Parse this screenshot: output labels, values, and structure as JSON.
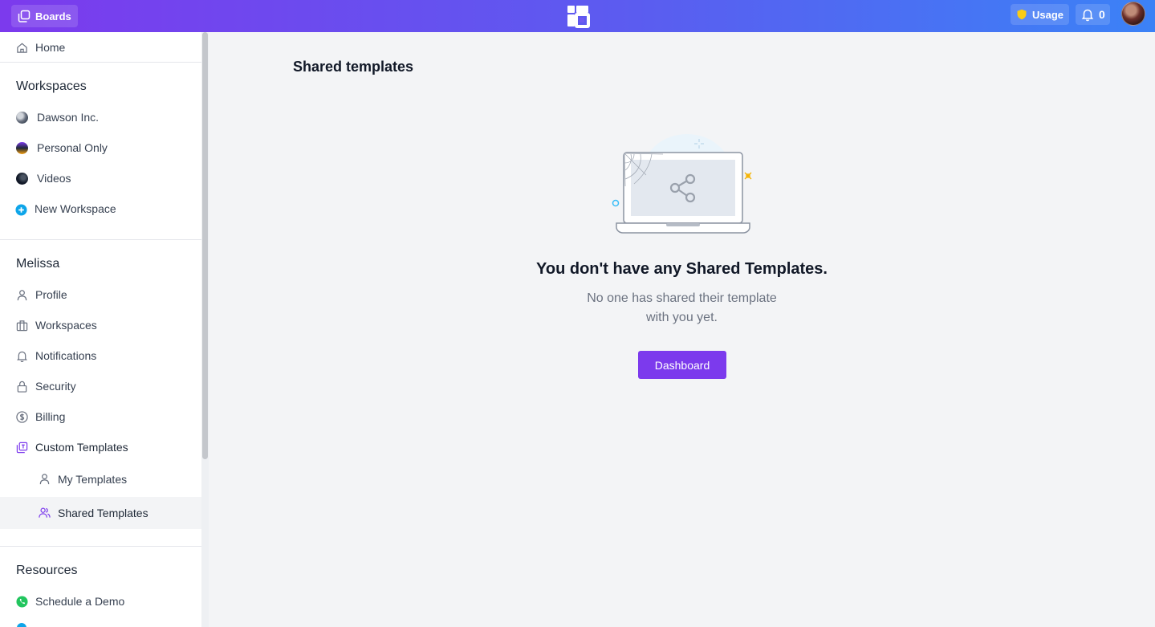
{
  "topbar": {
    "boards_label": "Boards",
    "usage_label": "Usage",
    "notification_count": "0"
  },
  "sidebar": {
    "home": "Home",
    "workspaces_title": "Workspaces",
    "workspaces": [
      {
        "label": "Dawson Inc."
      },
      {
        "label": "Personal Only"
      },
      {
        "label": "Videos"
      }
    ],
    "new_workspace": "New Workspace",
    "user_title": "Melissa",
    "user_items": [
      {
        "label": "Profile",
        "icon": "user-icon"
      },
      {
        "label": "Workspaces",
        "icon": "briefcase-icon"
      },
      {
        "label": "Notifications",
        "icon": "bell-icon"
      },
      {
        "label": "Security",
        "icon": "lock-icon"
      },
      {
        "label": "Billing",
        "icon": "dollar-icon"
      },
      {
        "label": "Custom Templates",
        "icon": "template-icon"
      }
    ],
    "template_sub_items": [
      {
        "label": "My Templates",
        "icon": "user-icon"
      },
      {
        "label": "Shared Templates",
        "icon": "users-icon",
        "active": true
      }
    ],
    "resources_title": "Resources",
    "resources_items": [
      {
        "label": "Schedule a Demo",
        "icon": "phone-icon"
      }
    ]
  },
  "main": {
    "page_title": "Shared templates",
    "empty_title": "You don't have any Shared Templates.",
    "empty_desc_line1": "No one has shared their template",
    "empty_desc_line2": "with you yet.",
    "dashboard_button": "Dashboard"
  },
  "colors": {
    "accent": "#7c3aed",
    "topbar_start": "#7c3aed",
    "topbar_end": "#3b82f6"
  }
}
